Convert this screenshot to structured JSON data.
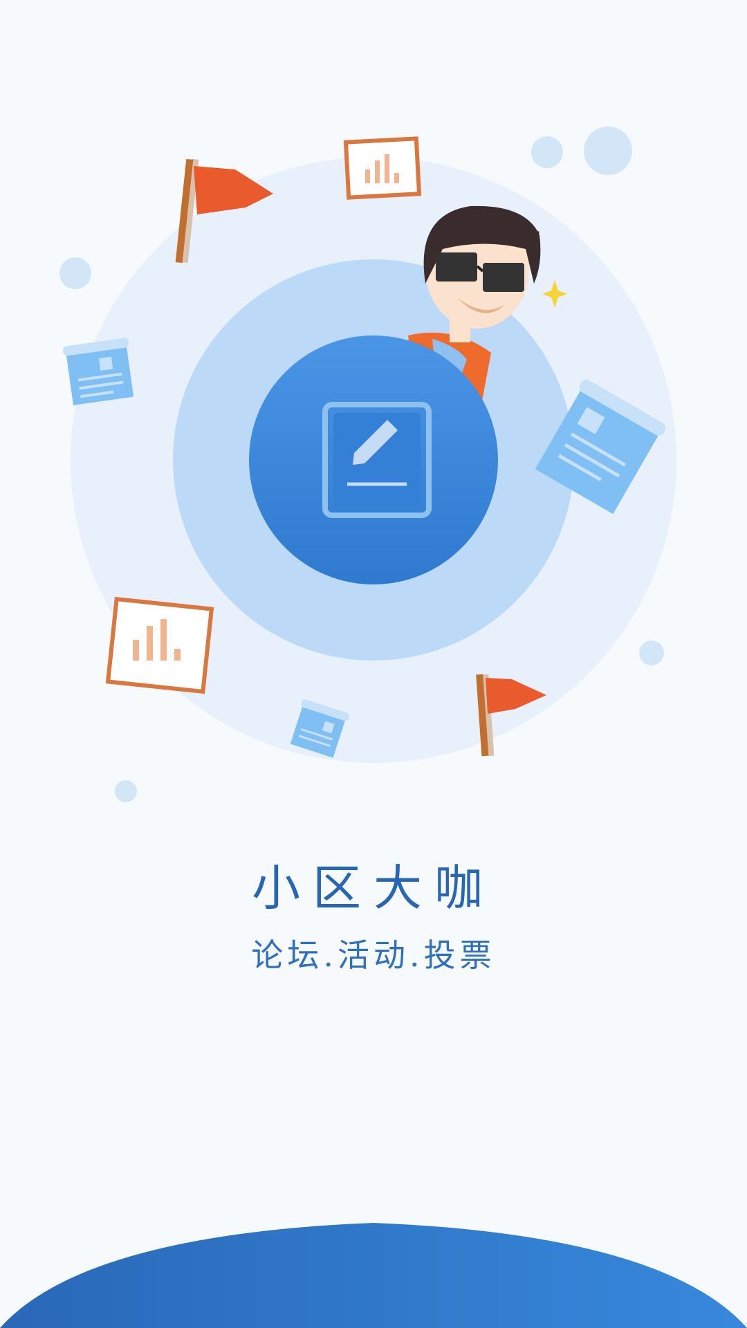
{
  "splash": {
    "title": "小区大咖",
    "subtitle": "论坛.活动.投票"
  },
  "icons": {
    "center": "edit-note-icon",
    "character": "cool-guy-mascot",
    "decorations": [
      "flag-icon",
      "chart-board-icon",
      "newspaper-icon",
      "sparkle-icon"
    ]
  },
  "colors": {
    "accent": "#2866b4",
    "background": "#f7fafd",
    "circle_outer": "#e7f0fb",
    "circle_mid": "#bcdaf7",
    "circle_inner": "#3a86d8",
    "flag": "#e95a2c",
    "board": "#d9773f"
  }
}
